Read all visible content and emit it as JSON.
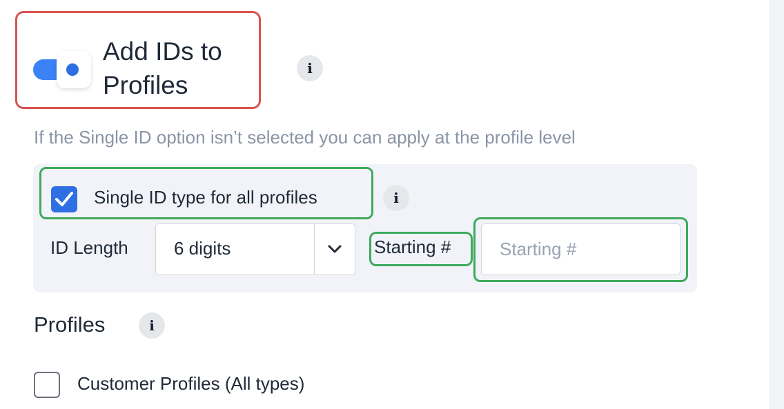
{
  "header": {
    "title": "Add IDs to Profiles",
    "toggle_on": true,
    "info_icon": "i"
  },
  "description": "If the Single ID option isn’t selected you can apply at the profile level",
  "single_id": {
    "label": "Single ID type for all profiles",
    "checked": true,
    "info_icon": "i"
  },
  "id_length": {
    "label": "ID Length",
    "selected": "6 digits"
  },
  "starting": {
    "label": "Starting #",
    "placeholder": "Starting #",
    "value": ""
  },
  "profiles": {
    "heading": "Profiles",
    "info_icon": "i",
    "items": [
      {
        "label": "Customer Profiles (All types)",
        "checked": false
      }
    ]
  },
  "colors": {
    "accent": "#3b82f6",
    "highlight_red": "#d9534f",
    "highlight_green": "#3daa5c"
  },
  "icons": [
    "toggle-switch",
    "info-icon",
    "checkmark-icon",
    "chevron-down-icon"
  ]
}
